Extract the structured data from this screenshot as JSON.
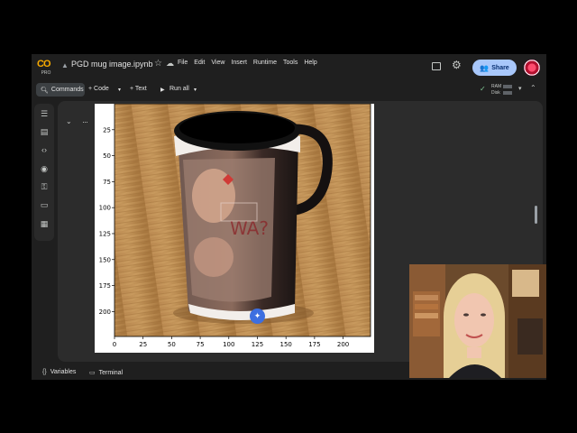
{
  "app": {
    "logo_text": "CO",
    "logo_tier": "PRO",
    "title": "PGD mug image.ipynb",
    "menu": [
      "File",
      "Edit",
      "View",
      "Insert",
      "Runtime",
      "Tools",
      "Help"
    ],
    "share_label": "Share",
    "accent": "#a8c7fa"
  },
  "toolbar": {
    "commands_label": "Commands",
    "code_label": "+ Code",
    "text_label": "+ Text",
    "run_all_label": "Run all",
    "ram_label": "RAM",
    "disk_label": "Disk"
  },
  "statusbar": {
    "variables_label": "Variables",
    "terminal_label": "Terminal"
  },
  "chart_data": {
    "type": "image",
    "x_ticks": [
      "0",
      "25",
      "50",
      "75",
      "100",
      "125",
      "150",
      "175",
      "200"
    ],
    "y_ticks": [
      "25",
      "50",
      "75",
      "100",
      "125",
      "150",
      "175",
      "200"
    ],
    "x_range": [
      0,
      224
    ],
    "y_range": [
      0,
      224
    ]
  },
  "icons": {
    "rail": [
      "list-icon",
      "search-doc-icon",
      "code-icon",
      "eye-icon",
      "key-icon",
      "folder-icon",
      "table-icon"
    ]
  }
}
